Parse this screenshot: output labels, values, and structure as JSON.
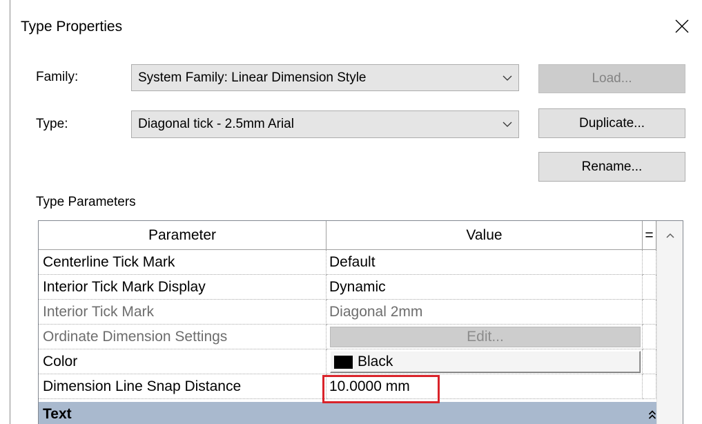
{
  "window": {
    "title": "Type Properties",
    "close_icon": "close-icon"
  },
  "family": {
    "label": "Family:",
    "value": "System Family: Linear Dimension Style",
    "icon": "chevron-down-icon"
  },
  "type": {
    "label": "Type:",
    "value": "Diagonal tick - 2.5mm Arial",
    "icon": "chevron-down-icon"
  },
  "buttons": {
    "load": {
      "label": "Load...",
      "enabled": false
    },
    "duplicate": {
      "label": "Duplicate...",
      "enabled": true
    },
    "rename": {
      "label": "Rename...",
      "enabled": true
    }
  },
  "type_parameters": {
    "label": "Type Parameters",
    "columns": {
      "parameter": "Parameter",
      "value": "Value",
      "formula": "="
    },
    "rows": [
      {
        "parameter": "Centerline Tick Mark",
        "value": "Default",
        "enabled": true
      },
      {
        "parameter": "Interior Tick Mark Display",
        "value": "Dynamic",
        "enabled": true
      },
      {
        "parameter": "Interior Tick Mark",
        "value": "Diagonal 2mm",
        "enabled": false
      },
      {
        "parameter": "Ordinate Dimension Settings",
        "value": "Edit...",
        "enabled": false
      },
      {
        "parameter": "Color",
        "value": "Black",
        "swatch": "#000000",
        "enabled": true
      },
      {
        "parameter": "Dimension Line Snap Distance",
        "value": "10.0000 mm",
        "enabled": true,
        "highlighted": true
      }
    ],
    "groups": [
      {
        "label": "Text",
        "icon": "double-chevron-up-icon"
      }
    ],
    "scrollbar_icon": "scroll-up-icon"
  },
  "colors": {
    "highlight": "#d9232a",
    "group_header": "#a9b9ce",
    "disabled_text": "#6d6d6d",
    "disabled_button": "#cccccc",
    "button": "#e1e1e1"
  }
}
